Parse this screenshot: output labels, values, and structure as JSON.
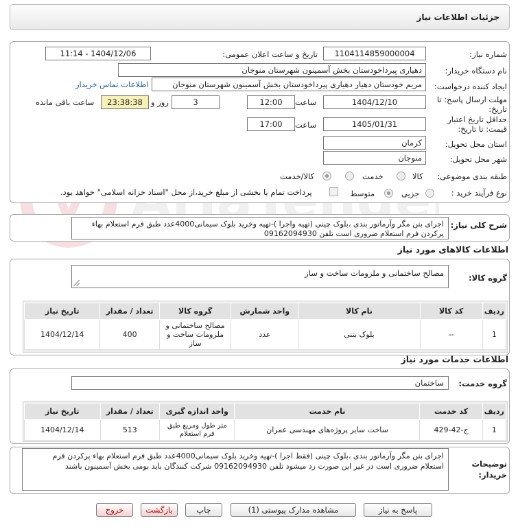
{
  "header": {
    "title": "جزئیات اطلاعات نیاز"
  },
  "form": {
    "need_number_label": "شماره نیاز:",
    "need_number": "1104114859000004",
    "announce_label": "تاریخ و ساعت اعلان عمومی:",
    "announce_value": "1404/12/06 - 11:14",
    "buyer_label": "نام دستگاه خریدار:",
    "buyer_value": "دهیاری پیرداخودستان  بخش آسمینون شهرستان منوجان",
    "creator_label": "ایجاد کننده درخواست:",
    "creator_value": "مریم خودستان دهیار   دهیاری پیرداخودستان  بخش آسمینون شهرستان منوجان",
    "contact_link": "اطلاعات تماس خریدار",
    "deadline_label": "مهلت ارسال پاسخ: تا تاریخ:",
    "deadline_date": "1404/12/10",
    "time_label": "ساعت",
    "deadline_time": "12:00",
    "days_value": "3",
    "days_label": "روز و",
    "remaining_time": "23:38:38",
    "remaining_label": "ساعت باقی مانده",
    "validity_label": "حداقل تاریخ اعتبار قیمت: تا تاریخ:",
    "validity_date": "1405/01/31",
    "validity_time": "17:00",
    "province_label": "استان محل تحویل:",
    "province_value": "کرمان",
    "city_label": "شهر محل تحویل:",
    "city_value": "منوجان",
    "category_label": "طبقه بندی موضوعی:",
    "category_options": [
      "کالا",
      "خدمت",
      "کالا/خدمت"
    ],
    "process_label": "نوع فرآیند خرید :",
    "process_options": [
      "جزیی",
      "متوسط"
    ],
    "payment_note": "پرداخت تمام یا بخشی از مبلغ خرید،از محل \"اسناد خزانه اسلامی\" خواهد بود."
  },
  "summary": {
    "label": "شرح کلی نیاز:",
    "text": "اجرای بتن مگر وآرماتور بندی ،بلوک چینی (تهیه واجرا )-تهیه وخرید بلوک سیمانی4000عدد طبق فرم استعلام بهاء پرکردن فرم استعلام ضروری است تلفن 09162094930"
  },
  "goods": {
    "section_title": "اطلاعات کالاهای مورد نیاز",
    "group_label": "گروه کالا:",
    "group_value": "مصالح ساختمانی و ملزومات ساخت و ساز",
    "columns": [
      "ردیف",
      "کد کالا",
      "نام کالا",
      "واحد شمارش",
      "گروه کالا",
      "تعداد / مقدار",
      "تاریخ نیاز"
    ],
    "rows": [
      [
        "1",
        "--",
        "بلوک بتنی",
        "عدد",
        "مصالح ساختمانی و ملزومات ساخت و ساز",
        "400",
        "1404/12/14"
      ]
    ]
  },
  "services": {
    "section_title": "اطلاعات خدمات مورد نیاز",
    "group_label": "گروه خدمت:",
    "group_value": "ساختمان",
    "columns": [
      "ردیف",
      "کد خدمت",
      "نام خدمت",
      "واحد اندازه گیری",
      "تعداد / مقدار",
      "تاریخ نیاز"
    ],
    "rows": [
      [
        "1",
        "ج-42-429",
        "ساخت سایر پروژه‌های مهندسی عمران",
        "متر طول ومربع طبق فرم استعلام",
        "513",
        "1404/12/14"
      ]
    ]
  },
  "buyer_notes": {
    "label": "توضیحات خریدار:",
    "text": "اجرای بتن مگر وآرماتور بندی ،بلوک چینی (فقط اجرا )-تهیه وخرید بلوک سیمانی4000عدد طبق فرم استعلام بهاء پرکردن فرم استعلام ضروری است در غیر این صورت رد میشود  تلفن 09162094930 شرکت کنندگان باید بومی بخش آسمینون باشند"
  },
  "buttons": {
    "reply": "پاسخ به نیاز",
    "attachments": "مشاهده مدارک پیوستی (1)",
    "print": "چاپ",
    "back": "بازگشت",
    "exit": "خروج"
  },
  "watermark": {
    "text": "AriaTender.neT"
  }
}
